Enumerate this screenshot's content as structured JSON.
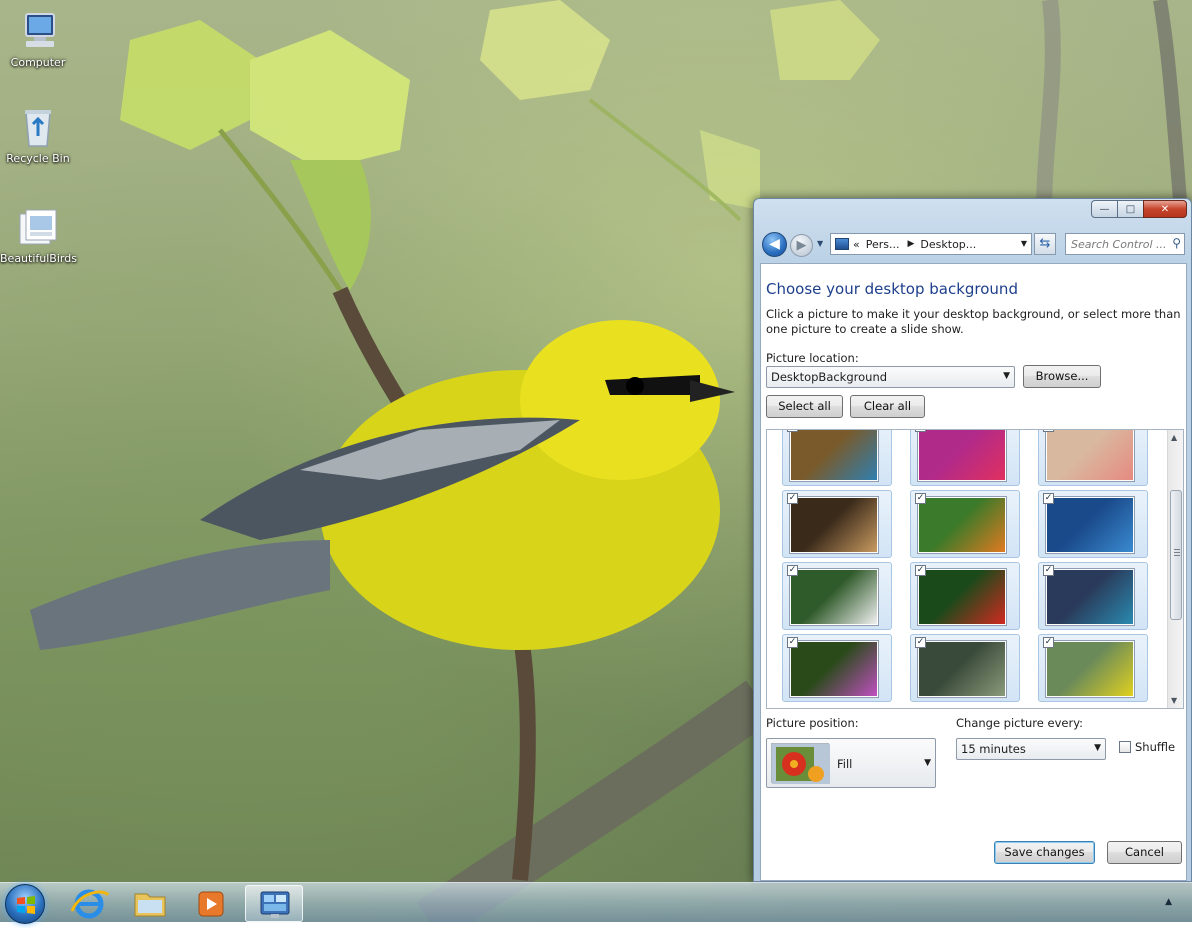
{
  "desktop": {
    "icons": [
      {
        "label": "Computer"
      },
      {
        "label": "Recycle Bin"
      },
      {
        "label": "BeautifulBirds"
      }
    ]
  },
  "window": {
    "caption_buttons": {
      "minimize": "—",
      "maximize": "□",
      "close": "✕"
    },
    "nav": {
      "address_prefix": "«",
      "crumbs": [
        "Pers...",
        "Desktop..."
      ],
      "search_placeholder": "Search Control ..."
    },
    "heading": "Choose your desktop background",
    "description": "Click a picture to make it your desktop background, or select more than one picture to create a slide show.",
    "picture_location_label": "Picture location:",
    "picture_location_value": "DesktopBackground",
    "browse_label": "Browse...",
    "select_all_label": "Select all",
    "clear_all_label": "Clear all",
    "thumbnails": [
      {
        "name": "kingfisher",
        "checked": true,
        "colors": [
          "#7a5a2a",
          "#2f7fb0"
        ]
      },
      {
        "name": "hummingbird-pink",
        "checked": true,
        "colors": [
          "#b02a8a",
          "#e03060"
        ]
      },
      {
        "name": "flamingo",
        "checked": true,
        "colors": [
          "#d9b8a0",
          "#e68a80"
        ]
      },
      {
        "name": "swan-lake",
        "checked": true,
        "colors": [
          "#3a2a1a",
          "#c89a60"
        ]
      },
      {
        "name": "lorikeet",
        "checked": true,
        "colors": [
          "#3a7a2a",
          "#e07a20"
        ]
      },
      {
        "name": "crowned-pigeon",
        "checked": true,
        "colors": [
          "#1a4a8a",
          "#3a8ad0"
        ]
      },
      {
        "name": "swans-green",
        "checked": true,
        "colors": [
          "#2f5a2a",
          "#f0f0f0"
        ]
      },
      {
        "name": "macaw",
        "checked": true,
        "colors": [
          "#1a4a1a",
          "#d02a20"
        ]
      },
      {
        "name": "peacock-feathers",
        "checked": true,
        "colors": [
          "#2a3a5a",
          "#2a8ab0"
        ]
      },
      {
        "name": "hummingbird-flower",
        "checked": true,
        "colors": [
          "#2a4a1a",
          "#c050c0"
        ]
      },
      {
        "name": "peacock",
        "checked": true,
        "colors": [
          "#3a4a3a",
          "#8a9a7a"
        ]
      },
      {
        "name": "yellow-bird",
        "checked": true,
        "colors": [
          "#6a8a5a",
          "#e0d020"
        ]
      }
    ],
    "picture_position_label": "Picture position:",
    "picture_position_value": "Fill",
    "change_every_label": "Change picture every:",
    "change_every_value": "15 minutes",
    "shuffle_label": "Shuffle",
    "shuffle_checked": false,
    "save_label": "Save changes",
    "cancel_label": "Cancel"
  },
  "taskbar": {
    "items": [
      "start-menu",
      "internet-explorer",
      "windows-explorer",
      "media-player",
      "control-panel"
    ],
    "active": "control-panel"
  }
}
